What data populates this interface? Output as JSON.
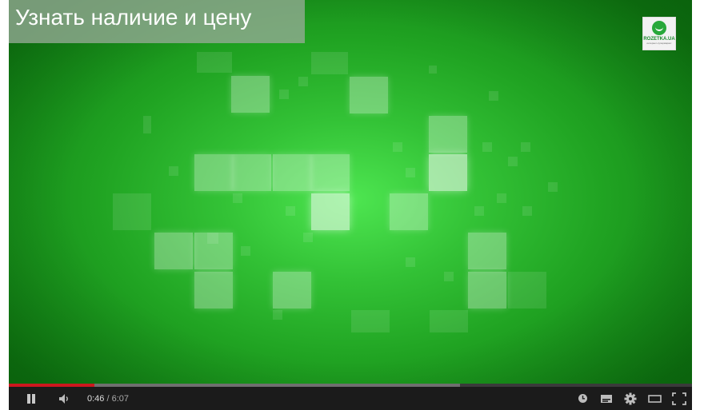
{
  "video": {
    "title_link": "Узнать наличие и цену",
    "watermark": {
      "name": "ROZETKA.UA",
      "subtitle": "интернет-супермаркет"
    }
  },
  "playback": {
    "current_time": "0:46",
    "separator": "/",
    "duration": "6:07",
    "played_fraction": 0.125,
    "loaded_fraction": 0.66
  },
  "controls": {
    "left": [
      "pause-icon",
      "volume-icon"
    ],
    "right": [
      "watch-later-icon",
      "captions-icon",
      "settings-icon",
      "theater-mode-icon",
      "fullscreen-icon"
    ]
  },
  "colors": {
    "video_background": "#33c236",
    "progress_played": "#cc181e",
    "controls_bar": "#1b1b1b"
  }
}
